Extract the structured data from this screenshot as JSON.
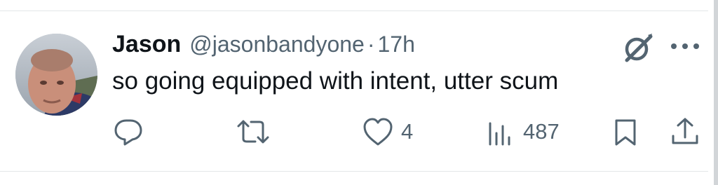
{
  "tweet": {
    "author_name": "Jason",
    "author_handle": "@jasonbandyone",
    "separator": "·",
    "time_ago": "17h",
    "text": "so going equipped with intent, utter scum"
  },
  "actions": {
    "reply_count": "",
    "retweet_count": "",
    "like_count": "4",
    "view_count": "487"
  },
  "icons": {
    "reply": "reply-icon",
    "retweet": "retweet-icon",
    "like": "heart-icon",
    "views": "bar-chart-icon",
    "bookmark": "bookmark-icon",
    "share": "share-icon",
    "grok": "grok-icon",
    "more": "more-icon"
  },
  "colors": {
    "text_primary": "#0f1419",
    "text_secondary": "#536471",
    "divider": "#e3e6e8"
  }
}
